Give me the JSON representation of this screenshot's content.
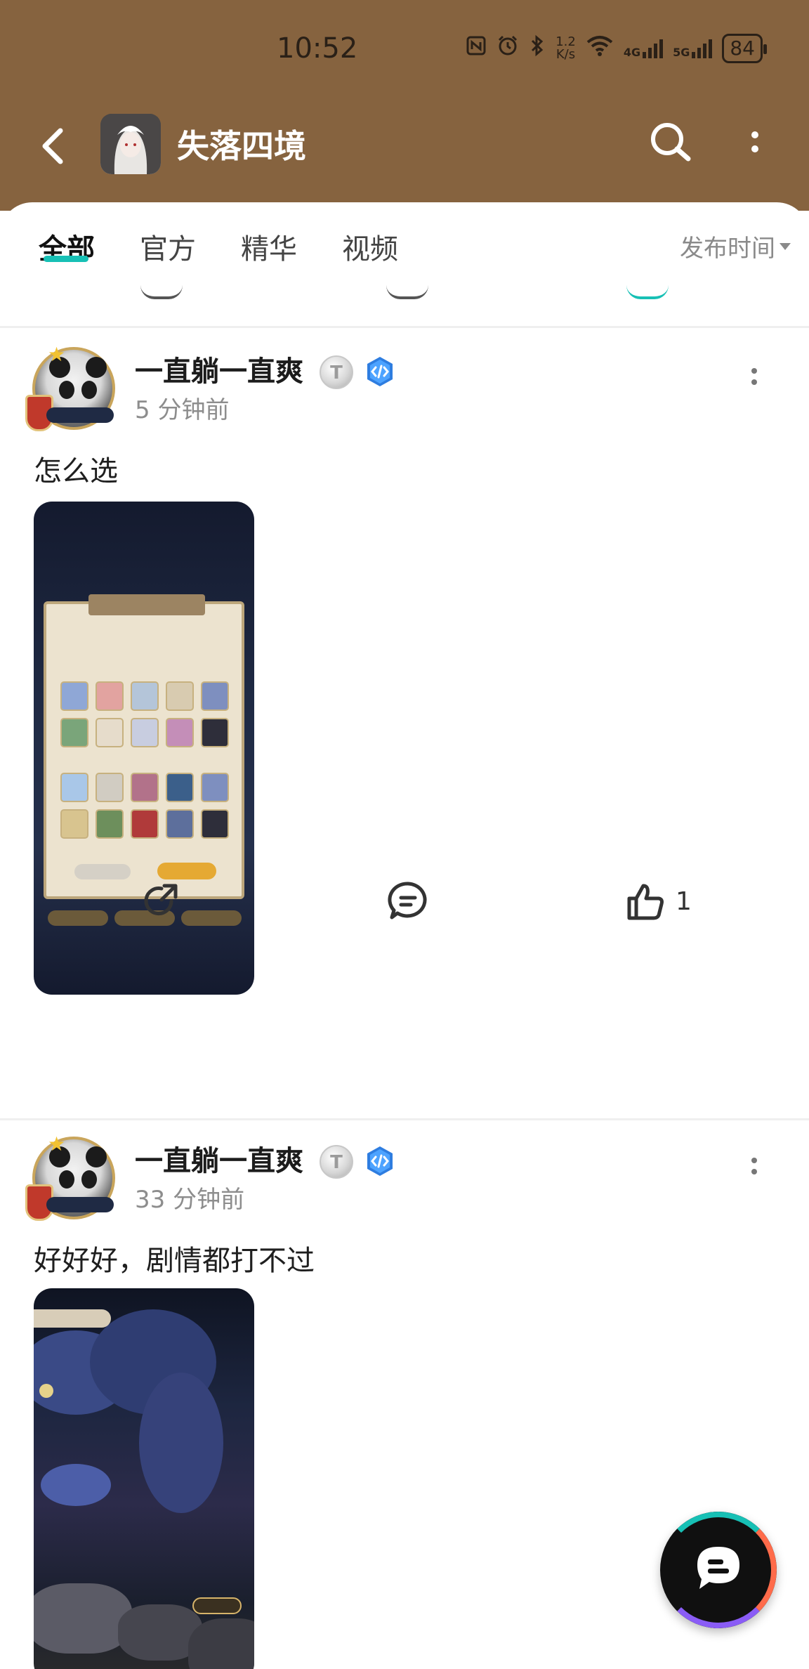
{
  "status_bar": {
    "time": "10:52",
    "network_speed_top": "1.2",
    "network_speed_bottom": "K/s",
    "net1": "4G",
    "net2": "5G",
    "battery": "84"
  },
  "nav": {
    "title": "失落四境",
    "icons": [
      "back-arrow-icon",
      "search-icon",
      "more-vertical-icon"
    ]
  },
  "tabs": [
    {
      "label": "全部",
      "active": true
    },
    {
      "label": "官方",
      "active": false
    },
    {
      "label": "精华",
      "active": false
    },
    {
      "label": "视频",
      "active": false
    }
  ],
  "sort": {
    "label": "发布时间"
  },
  "accent_color": "#17c0b5",
  "header_color": "#86633f",
  "posts": [
    {
      "username": "一直躺一直爽",
      "level": "T",
      "time": "5 分钟前",
      "text": "怎么选",
      "likes": "1"
    },
    {
      "username": "一直躺一直爽",
      "level": "T",
      "time": "33 分钟前",
      "text": "好好好，剧情都打不过"
    }
  ]
}
